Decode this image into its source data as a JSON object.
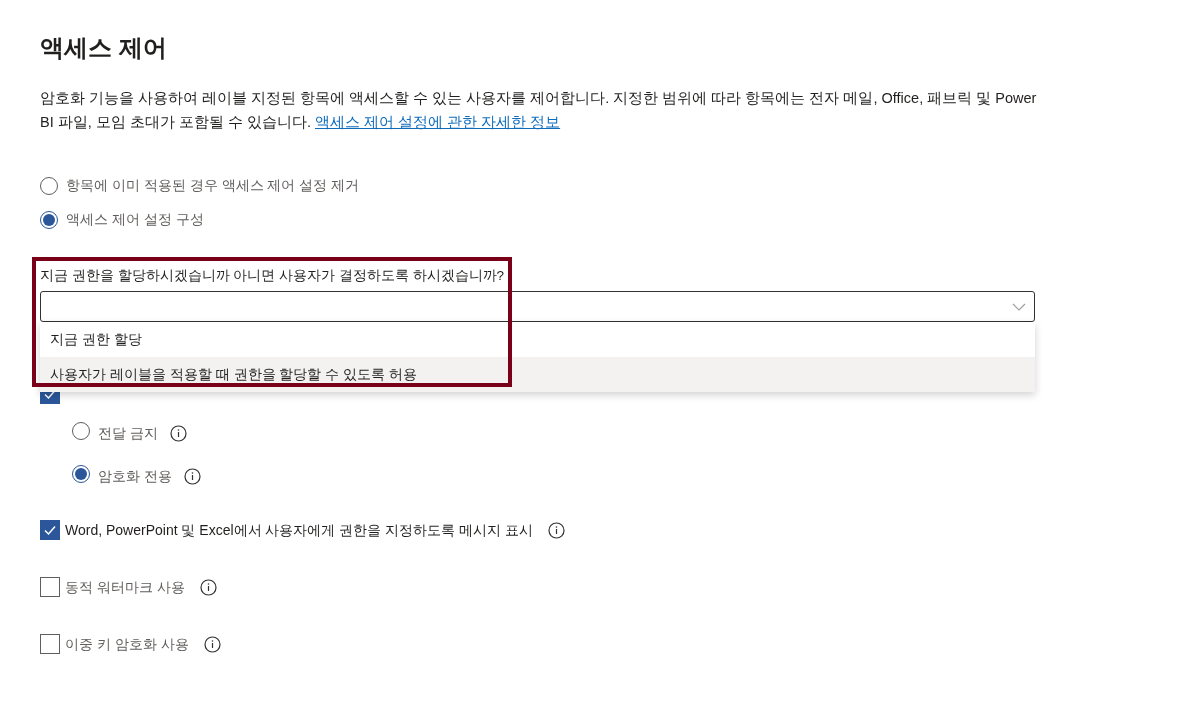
{
  "title": "액세스 제어",
  "description": {
    "text": "암호화 기능을 사용하여 레이블 지정된 항목에 액세스할 수 있는 사용자를 제어합니다. 지정한 범위에 따라 항목에는 전자 메일, Office, 패브릭 및 Power BI 파일, 모임 초대가 포함될 수 있습니다.",
    "link": "액세스 제어 설정에 관한 자세한 정보"
  },
  "access_options": [
    {
      "label": "항목에 이미 적용된 경우 액세스 제어 설정 제거",
      "selected": false
    },
    {
      "label": "액세스 제어 설정 구성",
      "selected": true
    }
  ],
  "permission_question": {
    "label": "지금 권한을 할당하시겠습니까 아니면 사용자가 결정하도록 하시겠습니까?",
    "expanded": true,
    "options": [
      {
        "label": "지금 권한 할당",
        "highlighted": false
      },
      {
        "label": "사용자가 레이블을 적용할 때 권한을 할당할 수 있도록 허용",
        "highlighted": true
      }
    ]
  },
  "annotation": {
    "visible": true
  },
  "covered_checkbox": {
    "checked": true
  },
  "outlook_options": [
    {
      "label": "전달 금지",
      "selected": false
    },
    {
      "label": "암호화 전용",
      "selected": true
    }
  ],
  "checkboxes": [
    {
      "label": "Word, PowerPoint 및 Excel에서 사용자에게 권한을 지정하도록 메시지 표시",
      "checked": true
    },
    {
      "label": "동적 워터마크 사용",
      "checked": false
    },
    {
      "label": "이중 키 암호화 사용",
      "checked": false
    }
  ]
}
